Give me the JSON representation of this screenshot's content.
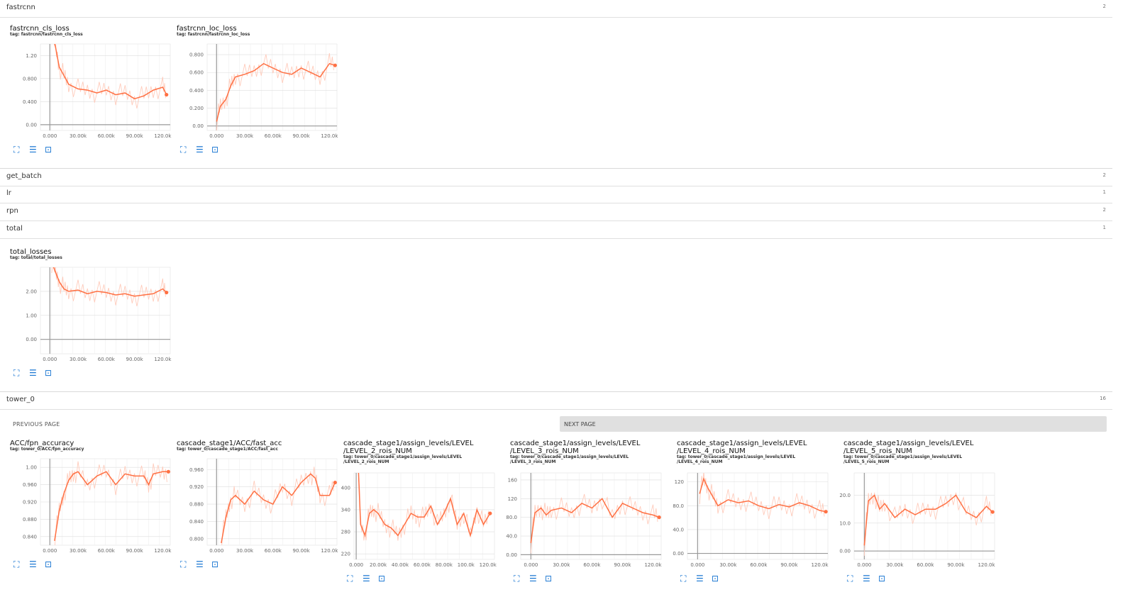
{
  "sections": [
    {
      "name": "fastrcnn",
      "count": "2"
    },
    {
      "name": "get_batch",
      "count": "2"
    },
    {
      "name": "lr",
      "count": "1"
    },
    {
      "name": "rpn",
      "count": "2"
    },
    {
      "name": "total",
      "count": "1"
    },
    {
      "name": "tower_0",
      "count": "16"
    }
  ],
  "pagination": {
    "prev_label": "PREVIOUS PAGE",
    "next_label": "NEXT PAGE"
  },
  "colors": {
    "smoothed": "#ff7043",
    "raw": "#ffccbc",
    "icon": "#1976d2"
  },
  "icons": [
    "fullscreen-icon",
    "list-icon",
    "fit-domain-icon"
  ],
  "charts": [
    {
      "title": "fastrcnn_cls_loss",
      "tag": "tag: fastrcnn/fastrcnn_cls_loss",
      "x_ticks": [
        "0.000",
        "30.00k",
        "60.00k",
        "90.00k",
        "120.0k"
      ],
      "y_ticks": [
        "0.00",
        "0.400",
        "0.800",
        "1.20"
      ],
      "chart_data": {
        "type": "line",
        "ylim": [
          -0.1,
          1.4
        ],
        "xlim": [
          -10000,
          128000
        ],
        "x": [
          2000,
          6000,
          10000,
          15000,
          20000,
          30000,
          40000,
          50000,
          60000,
          70000,
          80000,
          90000,
          100000,
          110000,
          120000,
          124000
        ],
        "values": [
          1.6,
          1.35,
          1.0,
          0.85,
          0.7,
          0.62,
          0.6,
          0.55,
          0.6,
          0.52,
          0.55,
          0.45,
          0.5,
          0.6,
          0.65,
          0.52
        ]
      }
    },
    {
      "title": "fastrcnn_loc_loss",
      "tag": "tag: fastrcnn/fastrcnn_loc_loss",
      "x_ticks": [
        "0.000",
        "30.00k",
        "60.00k",
        "90.00k",
        "120.0k"
      ],
      "y_ticks": [
        "0.00",
        "0.200",
        "0.400",
        "0.600",
        "0.800"
      ],
      "chart_data": {
        "type": "line",
        "ylim": [
          -0.05,
          0.92
        ],
        "xlim": [
          -10000,
          128000
        ],
        "x": [
          0,
          4000,
          10000,
          15000,
          20000,
          30000,
          40000,
          50000,
          60000,
          70000,
          80000,
          90000,
          100000,
          110000,
          120000,
          126000
        ],
        "values": [
          0.05,
          0.22,
          0.3,
          0.45,
          0.55,
          0.58,
          0.62,
          0.7,
          0.65,
          0.6,
          0.58,
          0.65,
          0.6,
          0.55,
          0.7,
          0.68
        ]
      }
    },
    {
      "title": "total_losses",
      "tag": "tag: total/total_losses",
      "x_ticks": [
        "0.000",
        "30.00k",
        "60.00k",
        "90.00k",
        "120.0k"
      ],
      "y_ticks": [
        "0.00",
        "1.00",
        "2.00"
      ],
      "chart_data": {
        "type": "line",
        "ylim": [
          -0.6,
          3.0
        ],
        "xlim": [
          -10000,
          128000
        ],
        "x": [
          2000,
          6000,
          10000,
          15000,
          20000,
          30000,
          40000,
          50000,
          60000,
          70000,
          80000,
          90000,
          100000,
          110000,
          120000,
          124000
        ],
        "values": [
          3.2,
          2.8,
          2.4,
          2.1,
          2.0,
          2.05,
          1.9,
          2.0,
          1.95,
          1.85,
          1.9,
          1.8,
          1.85,
          1.9,
          2.1,
          1.95
        ]
      }
    },
    {
      "title": "ACC/fpn_accuracy",
      "tag": "tag: tower_0/ACC/fpn_accuracy",
      "x_ticks": [
        "0.000",
        "30.00k",
        "60.00k",
        "90.00k",
        "120.0k"
      ],
      "y_ticks": [
        "0.840",
        "0.880",
        "0.920",
        "0.960",
        "1.00"
      ],
      "chart_data": {
        "type": "line",
        "ylim": [
          0.82,
          1.02
        ],
        "xlim": [
          -10000,
          128000
        ],
        "x": [
          5000,
          10000,
          15000,
          20000,
          25000,
          30000,
          40000,
          50000,
          60000,
          70000,
          80000,
          90000,
          100000,
          105000,
          110000,
          120000,
          126000
        ],
        "values": [
          0.83,
          0.9,
          0.94,
          0.97,
          0.985,
          0.99,
          0.96,
          0.98,
          0.99,
          0.96,
          0.985,
          0.98,
          0.98,
          0.96,
          0.985,
          0.99,
          0.99
        ]
      }
    },
    {
      "title": "cascade_stage1/ACC/fast_acc",
      "tag": "tag: tower_0/cascade_stage1/ACC/fast_acc",
      "x_ticks": [
        "0.000",
        "30.00k",
        "60.00k",
        "90.00k",
        "120.0k"
      ],
      "y_ticks": [
        "0.800",
        "0.840",
        "0.880",
        "0.920",
        "0.960"
      ],
      "chart_data": {
        "type": "line",
        "ylim": [
          0.785,
          0.985
        ],
        "xlim": [
          -10000,
          128000
        ],
        "x": [
          5000,
          10000,
          15000,
          20000,
          30000,
          40000,
          50000,
          60000,
          70000,
          80000,
          90000,
          100000,
          105000,
          110000,
          120000,
          126000
        ],
        "values": [
          0.79,
          0.85,
          0.89,
          0.9,
          0.88,
          0.91,
          0.89,
          0.88,
          0.92,
          0.9,
          0.93,
          0.95,
          0.94,
          0.9,
          0.9,
          0.93
        ]
      }
    },
    {
      "title_lines": [
        "cascade_stage1/assign_levels/LEVEL",
        "/LEVEL_2_rois_NUM"
      ],
      "tag_lines": [
        "tag: tower_0/cascade_stage1/assign_levels/LEVEL",
        "/LEVEL_2_rois_NUM"
      ],
      "x_ticks": [
        "0.000",
        "20.00k",
        "40.00k",
        "60.00k",
        "80.00k",
        "100.0k",
        "120.0k"
      ],
      "y_ticks": [
        "220",
        "280",
        "340",
        "400"
      ],
      "chart_data": {
        "type": "line",
        "ylim": [
          205,
          440
        ],
        "xlim": [
          -2000,
          126000
        ],
        "x": [
          2000,
          4000,
          8000,
          12000,
          16000,
          20000,
          26000,
          32000,
          38000,
          44000,
          50000,
          56000,
          62000,
          68000,
          74000,
          80000,
          86000,
          92000,
          98000,
          104000,
          110000,
          116000,
          122000
        ],
        "values": [
          450,
          300,
          270,
          330,
          340,
          330,
          300,
          290,
          270,
          300,
          330,
          320,
          320,
          350,
          300,
          330,
          370,
          300,
          330,
          270,
          340,
          300,
          330
        ]
      }
    },
    {
      "title_lines": [
        "cascade_stage1/assign_levels/LEVEL",
        "/LEVEL_3_rois_NUM"
      ],
      "tag_lines": [
        "tag: tower_0/cascade_stage1/assign_levels/LEVEL",
        "/LEVEL_3_rois_NUM"
      ],
      "x_ticks": [
        "0.000",
        "30.00k",
        "60.00k",
        "90.00k",
        "120.0k"
      ],
      "y_ticks": [
        "0.00",
        "40.0",
        "80.0",
        "120",
        "160"
      ],
      "chart_data": {
        "type": "line",
        "ylim": [
          -10,
          175
        ],
        "xlim": [
          -10000,
          128000
        ],
        "x": [
          0,
          4000,
          10000,
          15000,
          20000,
          30000,
          40000,
          50000,
          60000,
          70000,
          80000,
          90000,
          100000,
          110000,
          120000,
          126000
        ],
        "values": [
          25,
          90,
          100,
          85,
          95,
          100,
          90,
          110,
          100,
          120,
          80,
          110,
          100,
          90,
          85,
          80
        ]
      }
    },
    {
      "title_lines": [
        "cascade_stage1/assign_levels/LEVEL",
        "/LEVEL_4_rois_NUM"
      ],
      "tag_lines": [
        "tag: tower_0/cascade_stage1/assign_levels/LEVEL",
        "/LEVEL_4_rois_NUM"
      ],
      "x_ticks": [
        "0.000",
        "30.00k",
        "60.00k",
        "90.00k",
        "120.0k"
      ],
      "y_ticks": [
        "0.00",
        "40.0",
        "80.0",
        "120"
      ],
      "chart_data": {
        "type": "line",
        "ylim": [
          -10,
          135
        ],
        "xlim": [
          -10000,
          128000
        ],
        "x": [
          2000,
          6000,
          10000,
          15000,
          20000,
          30000,
          40000,
          50000,
          60000,
          70000,
          80000,
          90000,
          100000,
          110000,
          120000,
          126000
        ],
        "values": [
          100,
          125,
          110,
          95,
          80,
          90,
          85,
          88,
          80,
          75,
          82,
          78,
          85,
          80,
          72,
          70
        ]
      }
    },
    {
      "title_lines": [
        "cascade_stage1/assign_levels/LEVEL",
        "/LEVEL_5_rois_NUM"
      ],
      "tag_lines": [
        "tag: tower_0/cascade_stage1/assign_levels/LEVEL",
        "/LEVEL_5_rois_NUM"
      ],
      "x_ticks": [
        "0.000",
        "30.00k",
        "60.00k",
        "90.00k",
        "120.0k"
      ],
      "y_ticks": [
        "0.00",
        "10.0",
        "20.0"
      ],
      "chart_data": {
        "type": "line",
        "ylim": [
          -3,
          28
        ],
        "xlim": [
          -10000,
          128000
        ],
        "x": [
          0,
          4000,
          10000,
          15000,
          20000,
          30000,
          40000,
          50000,
          60000,
          70000,
          80000,
          90000,
          100000,
          110000,
          120000,
          126000
        ],
        "values": [
          2,
          18,
          20,
          15,
          17,
          12,
          15,
          13,
          15,
          15,
          17,
          20,
          14,
          12,
          16,
          14
        ]
      }
    }
  ]
}
